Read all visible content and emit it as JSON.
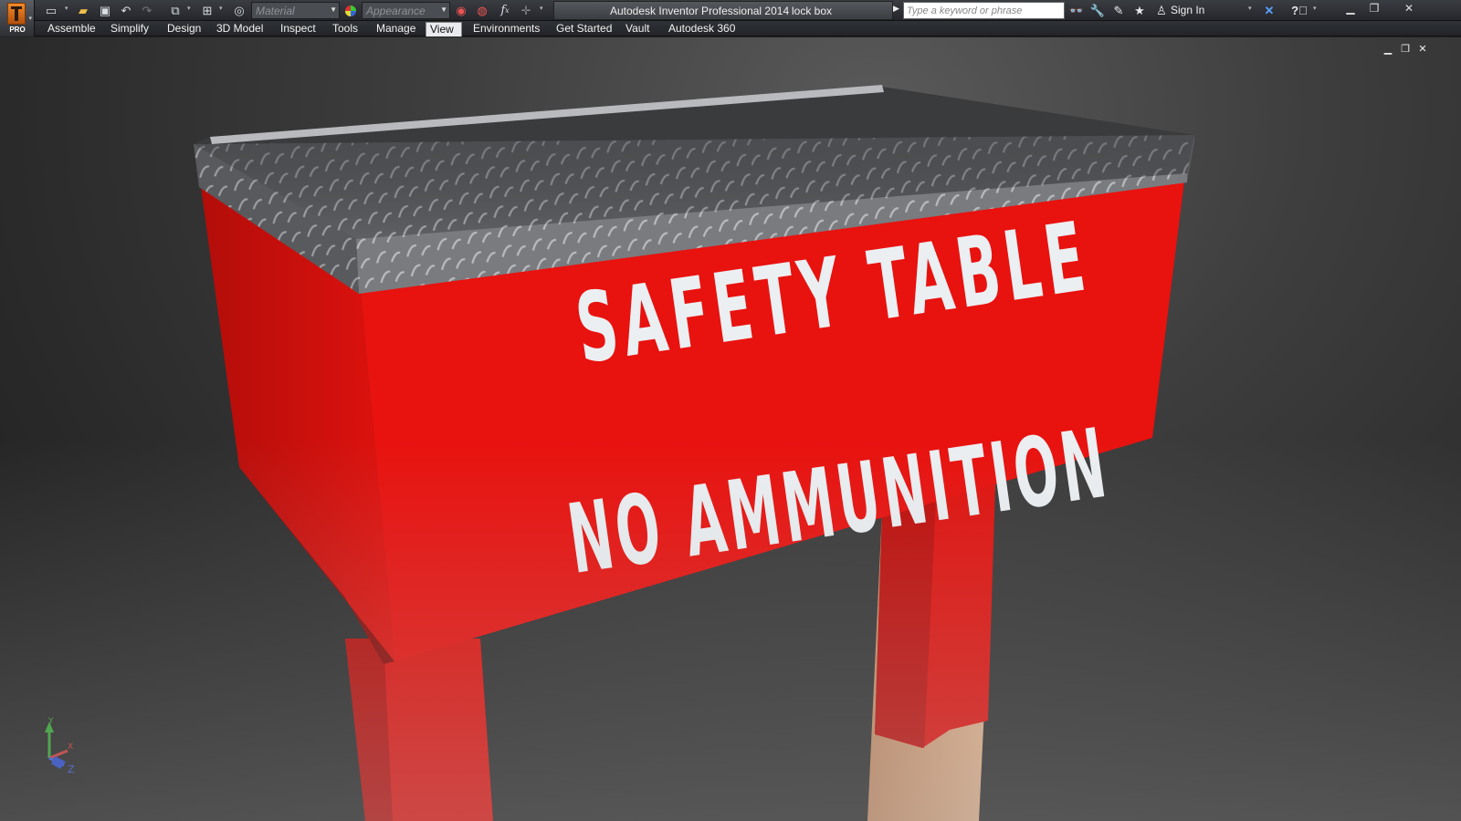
{
  "app": {
    "badge": "PRO",
    "title_app": "Autodesk Inventor Professional 2014",
    "title_doc": "lock box"
  },
  "qat": {
    "material_placeholder": "Material",
    "appearance_placeholder": "Appearance",
    "icons": [
      "new-icon",
      "open-icon",
      "save-icon",
      "undo-icon",
      "redo-icon",
      "return-icon",
      "update-icon",
      "color-wheel-icon",
      "adjust-icon",
      "clear-appearance-icon",
      "fx-parameters-icon",
      "measure-icon"
    ]
  },
  "search": {
    "placeholder": "Type a keyword or phrase"
  },
  "infocenter": {
    "sign_in": "Sign In"
  },
  "ribbon": {
    "tabs": [
      "Assemble",
      "Simplify",
      "Design",
      "3D Model",
      "Inspect",
      "Tools",
      "Manage",
      "View",
      "Environments",
      "Get Started",
      "Vault",
      "Autodesk 360"
    ],
    "active_tab": "View"
  },
  "model": {
    "sign_line1": "SAFETY TABLE",
    "sign_line2": "NO AMMUNITION",
    "body_color": "#e8120f",
    "lid_color": "#7a7c80",
    "wood_color": "#d7a27f"
  },
  "axes": {
    "x": "X",
    "y": "Y",
    "z": "Z"
  }
}
